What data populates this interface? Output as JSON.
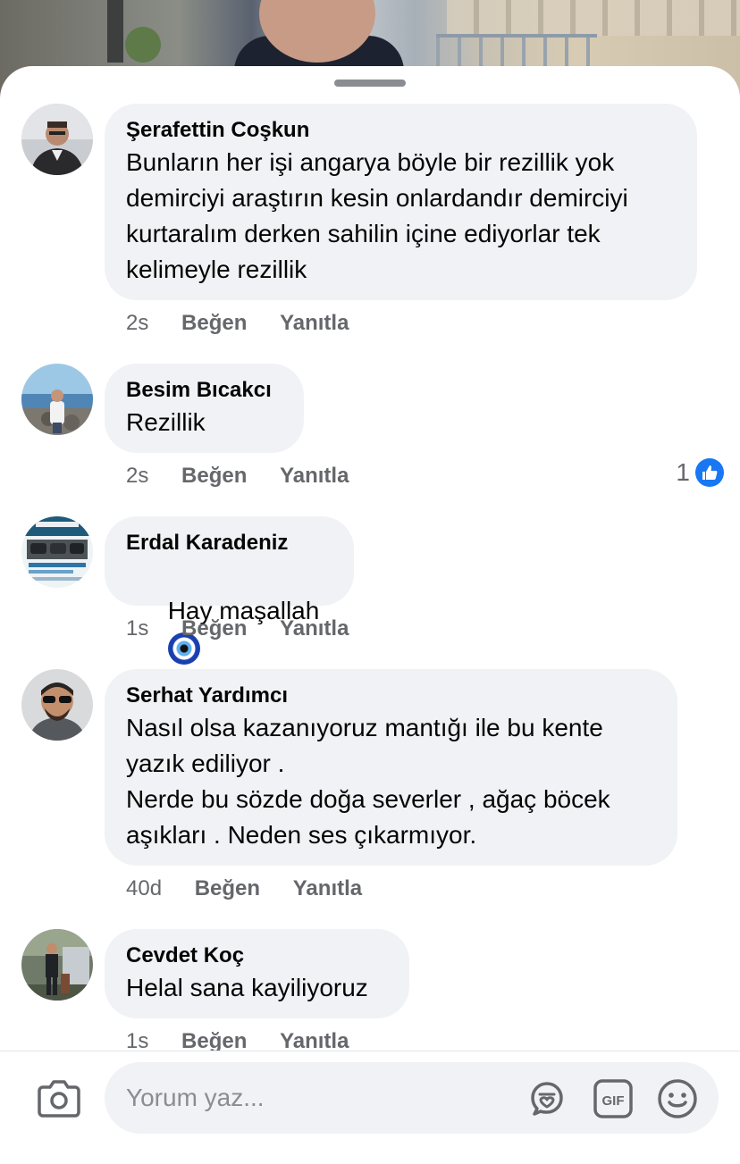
{
  "comments": [
    {
      "author": "Şerafettin Coşkun",
      "text": "Bunların her işi angarya böyle bir rezillik yok demirciyi araştırın kesin onlardandır demirciyi kurtaralım derken sahilin içine ediyorlar tek kelimeyle rezillik",
      "time": "2s",
      "like_label": "Beğen",
      "reply_label": "Yanıtla"
    },
    {
      "author": "Besim Bıcakcı",
      "text": "Rezillik",
      "time": "2s",
      "like_label": "Beğen",
      "reply_label": "Yanıtla",
      "reaction_count": "1"
    },
    {
      "author": "Erdal Karadeniz",
      "text": "Hay maşallah",
      "emoji": "nazar-evil-eye",
      "time": "1s",
      "like_label": "Beğen",
      "reply_label": "Yanıtla"
    },
    {
      "author": "Serhat Yardımcı",
      "text": "Nasıl olsa kazanıyoruz mantığı ile bu kente yazık ediliyor .\nNerde bu sözde doğa severler , ağaç böcek aşıkları . Neden ses çıkarmıyor.",
      "time": "40d",
      "like_label": "Beğen",
      "reply_label": "Yanıtla"
    },
    {
      "author": "Cevdet Koç",
      "text": "Helal sana kayiliyoruz",
      "time": "1s",
      "like_label": "Beğen",
      "reply_label": "Yanıtla"
    }
  ],
  "composer": {
    "placeholder": "Yorum yaz...",
    "icons": [
      "camera-icon",
      "avatar-sticker-icon",
      "gif-icon",
      "emoji-icon"
    ]
  },
  "colors": {
    "bubble": "#f0f2f5",
    "secondary_text": "#65676b",
    "like_blue": "#1877f2"
  }
}
